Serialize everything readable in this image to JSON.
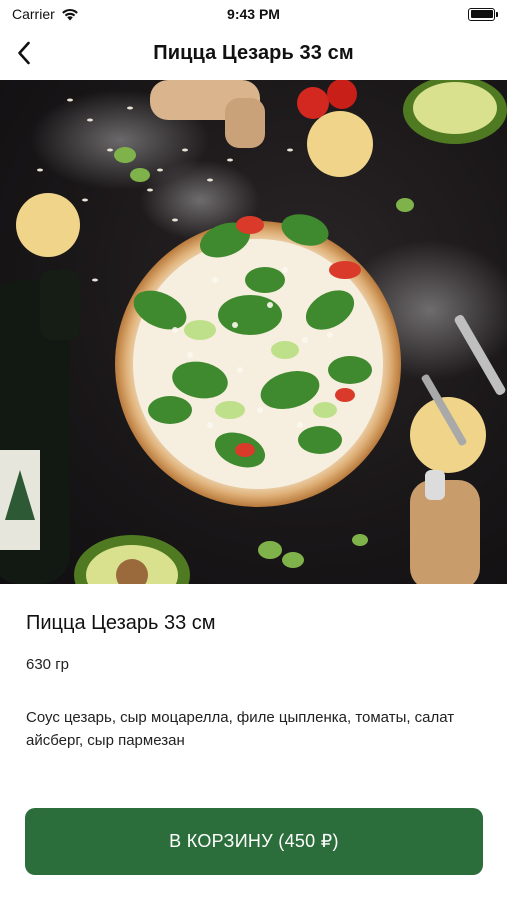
{
  "status_bar": {
    "carrier": "Carrier",
    "time": "9:43 PM"
  },
  "nav": {
    "title": "Пицца Цезарь 33 см",
    "back_icon": "chevron-left-icon"
  },
  "product": {
    "name": "Пицца Цезарь 33 см",
    "weight": "630 гр",
    "description": "Соус цезарь, сыр моцарелла, филе цыпленка, томаты, салат айсберг, сыр пармезан"
  },
  "cart_button": {
    "label": "В КОРЗИНУ (450 ₽)",
    "color": "#2c6e3b"
  }
}
